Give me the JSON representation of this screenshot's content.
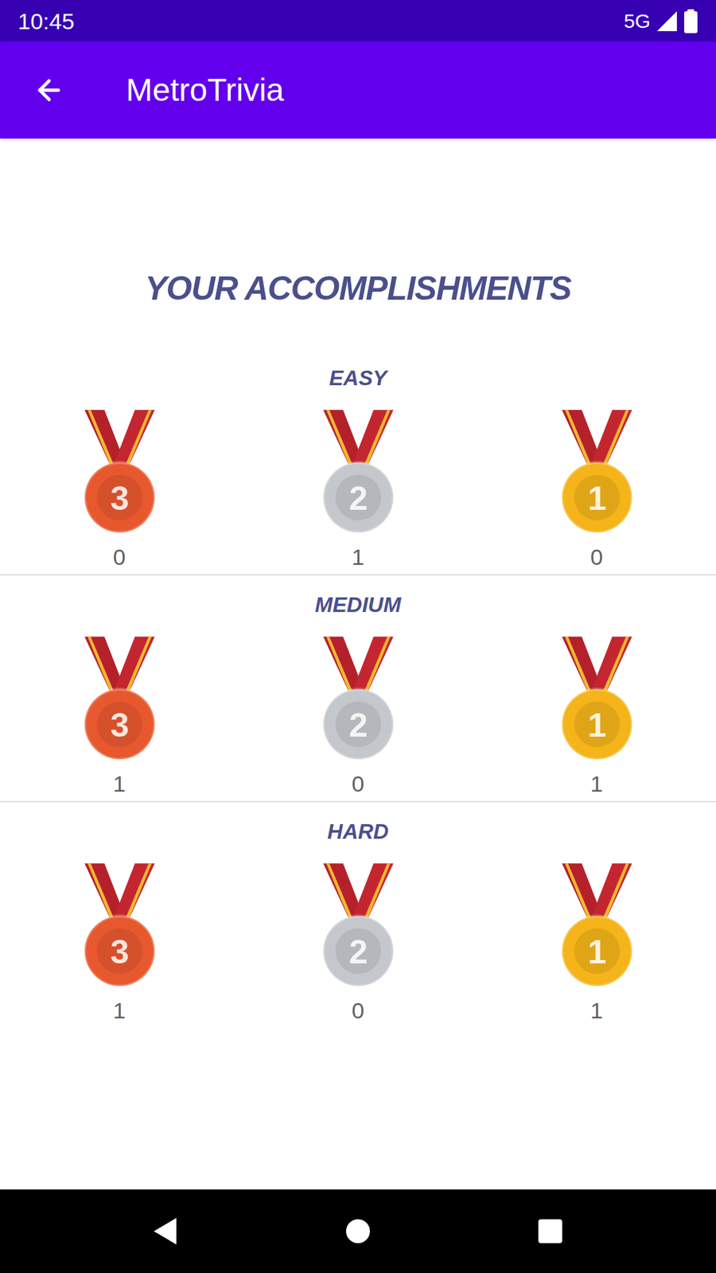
{
  "status_bar": {
    "time": "10:45",
    "network": "5G"
  },
  "app_bar": {
    "title": "MetroTrivia"
  },
  "heading": "YOUR ACCOMPLISHMENTS",
  "sections": [
    {
      "label": "EASY",
      "medals": [
        {
          "rank": "3",
          "count": "0",
          "color": "#e8582f"
        },
        {
          "rank": "2",
          "count": "1",
          "color": "#c4c7cb"
        },
        {
          "rank": "1",
          "count": "0",
          "color": "#f4b41a"
        }
      ]
    },
    {
      "label": "MEDIUM",
      "medals": [
        {
          "rank": "3",
          "count": "1",
          "color": "#e8582f"
        },
        {
          "rank": "2",
          "count": "0",
          "color": "#c4c7cb"
        },
        {
          "rank": "1",
          "count": "1",
          "color": "#f4b41a"
        }
      ]
    },
    {
      "label": "HARD",
      "medals": [
        {
          "rank": "3",
          "count": "1",
          "color": "#e8582f"
        },
        {
          "rank": "2",
          "count": "0",
          "color": "#c4c7cb"
        },
        {
          "rank": "1",
          "count": "1",
          "color": "#f4b41a"
        }
      ]
    }
  ]
}
